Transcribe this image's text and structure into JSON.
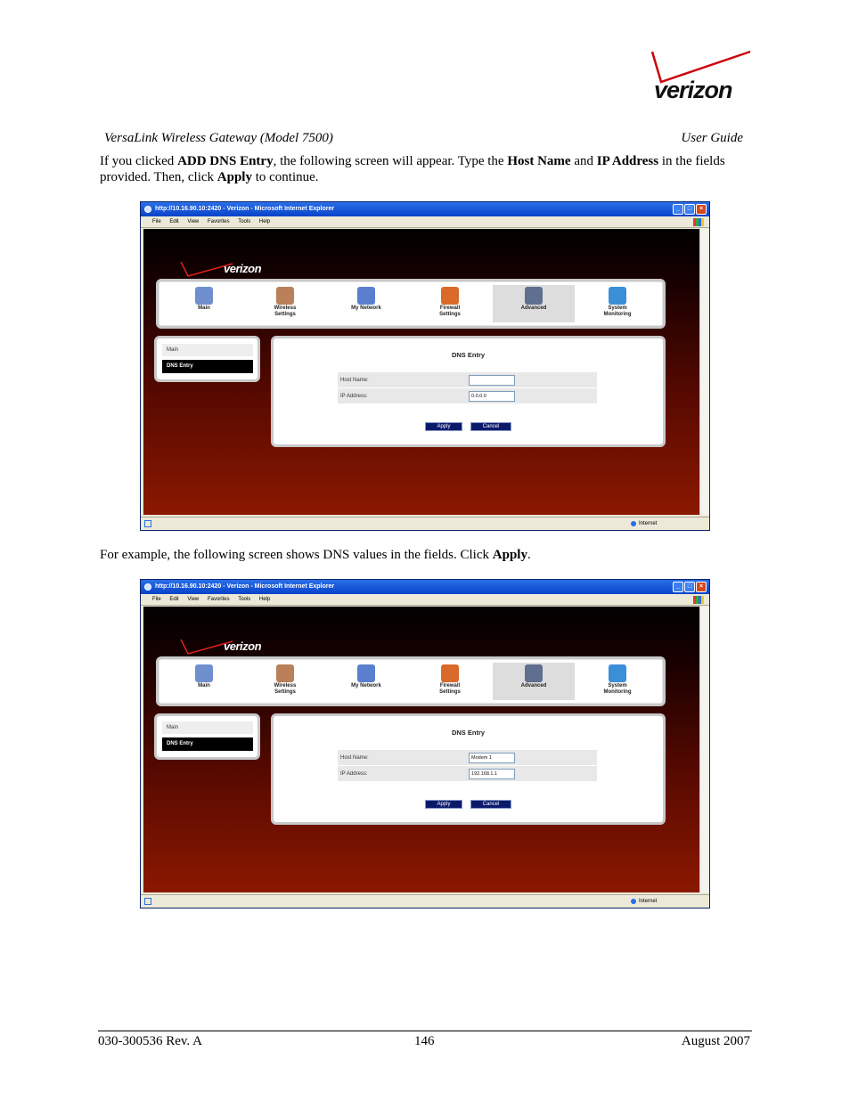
{
  "header": {
    "logo_text": "verizon",
    "doc_title": "VersaLink Wireless Gateway (Model 7500)",
    "doc_type": "User Guide"
  },
  "para1": {
    "t1": "If you clicked ",
    "b1": "ADD DNS Entry",
    "t2": ", the following screen will appear. Type the ",
    "b2": "Host Name",
    "t3": " and ",
    "b3": "IP Address",
    "t4": " in the fields provided. Then, click ",
    "b4": "Apply",
    "t5": " to continue."
  },
  "para2": {
    "t1": "For example, the following screen shows DNS values in the fields. Click ",
    "b1": "Apply",
    "t2": "."
  },
  "browser": {
    "title": "http://10.16.90.10:2420 - Verizon - Microsoft Internet Explorer",
    "menu": [
      "File",
      "Edit",
      "View",
      "Favorites",
      "Tools",
      "Help"
    ],
    "status_zone": "Internet",
    "logo_text": "verizon",
    "nav": [
      {
        "label1": "Main",
        "label2": "",
        "color": "#6f8fcf"
      },
      {
        "label1": "Wireless",
        "label2": "Settings",
        "color": "#b9805a"
      },
      {
        "label1": "My Network",
        "label2": "",
        "color": "#5a7fcf"
      },
      {
        "label1": "Firewall",
        "label2": "Settings",
        "color": "#d96a2a"
      },
      {
        "label1": "Advanced",
        "label2": "",
        "color": "#5f6f8f"
      },
      {
        "label1": "System",
        "label2": "Monitoring",
        "color": "#3a8fd9"
      }
    ],
    "side_main": "Main",
    "side_active": "DNS Entry",
    "panel_title": "DNS Entry",
    "host_label": "Host Name:",
    "ip_label": "IP Address:",
    "apply": "Apply",
    "cancel": "Cancel"
  },
  "shot1": {
    "host_value": "",
    "ip_value": "0.0.0.0"
  },
  "shot2": {
    "host_value": "Modem 1",
    "ip_value": "192.168.1.1"
  },
  "footer": {
    "doc_number": "030-300536 Rev. A",
    "page": "146",
    "date": "August 2007"
  }
}
